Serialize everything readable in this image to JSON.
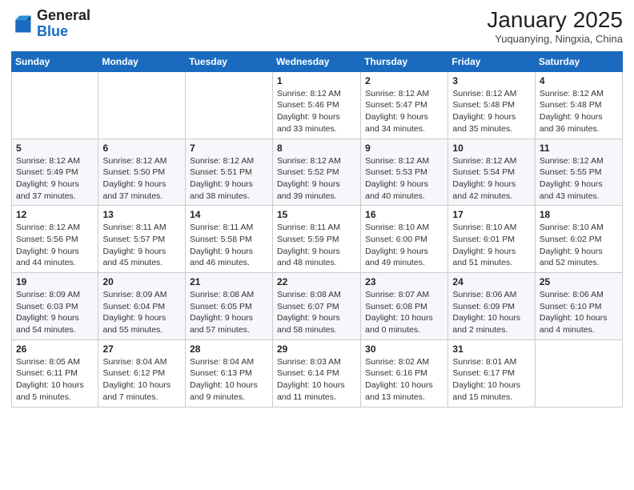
{
  "header": {
    "logo": {
      "line1": "General",
      "line2": "Blue"
    },
    "title": "January 2025",
    "location": "Yuquanying, Ningxia, China"
  },
  "weekdays": [
    "Sunday",
    "Monday",
    "Tuesday",
    "Wednesday",
    "Thursday",
    "Friday",
    "Saturday"
  ],
  "weeks": [
    [
      {
        "day": "",
        "sunrise": "",
        "sunset": "",
        "daylight": ""
      },
      {
        "day": "",
        "sunrise": "",
        "sunset": "",
        "daylight": ""
      },
      {
        "day": "",
        "sunrise": "",
        "sunset": "",
        "daylight": ""
      },
      {
        "day": "1",
        "sunrise": "Sunrise: 8:12 AM",
        "sunset": "Sunset: 5:46 PM",
        "daylight": "Daylight: 9 hours and 33 minutes."
      },
      {
        "day": "2",
        "sunrise": "Sunrise: 8:12 AM",
        "sunset": "Sunset: 5:47 PM",
        "daylight": "Daylight: 9 hours and 34 minutes."
      },
      {
        "day": "3",
        "sunrise": "Sunrise: 8:12 AM",
        "sunset": "Sunset: 5:48 PM",
        "daylight": "Daylight: 9 hours and 35 minutes."
      },
      {
        "day": "4",
        "sunrise": "Sunrise: 8:12 AM",
        "sunset": "Sunset: 5:48 PM",
        "daylight": "Daylight: 9 hours and 36 minutes."
      }
    ],
    [
      {
        "day": "5",
        "sunrise": "Sunrise: 8:12 AM",
        "sunset": "Sunset: 5:49 PM",
        "daylight": "Daylight: 9 hours and 37 minutes."
      },
      {
        "day": "6",
        "sunrise": "Sunrise: 8:12 AM",
        "sunset": "Sunset: 5:50 PM",
        "daylight": "Daylight: 9 hours and 37 minutes."
      },
      {
        "day": "7",
        "sunrise": "Sunrise: 8:12 AM",
        "sunset": "Sunset: 5:51 PM",
        "daylight": "Daylight: 9 hours and 38 minutes."
      },
      {
        "day": "8",
        "sunrise": "Sunrise: 8:12 AM",
        "sunset": "Sunset: 5:52 PM",
        "daylight": "Daylight: 9 hours and 39 minutes."
      },
      {
        "day": "9",
        "sunrise": "Sunrise: 8:12 AM",
        "sunset": "Sunset: 5:53 PM",
        "daylight": "Daylight: 9 hours and 40 minutes."
      },
      {
        "day": "10",
        "sunrise": "Sunrise: 8:12 AM",
        "sunset": "Sunset: 5:54 PM",
        "daylight": "Daylight: 9 hours and 42 minutes."
      },
      {
        "day": "11",
        "sunrise": "Sunrise: 8:12 AM",
        "sunset": "Sunset: 5:55 PM",
        "daylight": "Daylight: 9 hours and 43 minutes."
      }
    ],
    [
      {
        "day": "12",
        "sunrise": "Sunrise: 8:12 AM",
        "sunset": "Sunset: 5:56 PM",
        "daylight": "Daylight: 9 hours and 44 minutes."
      },
      {
        "day": "13",
        "sunrise": "Sunrise: 8:11 AM",
        "sunset": "Sunset: 5:57 PM",
        "daylight": "Daylight: 9 hours and 45 minutes."
      },
      {
        "day": "14",
        "sunrise": "Sunrise: 8:11 AM",
        "sunset": "Sunset: 5:58 PM",
        "daylight": "Daylight: 9 hours and 46 minutes."
      },
      {
        "day": "15",
        "sunrise": "Sunrise: 8:11 AM",
        "sunset": "Sunset: 5:59 PM",
        "daylight": "Daylight: 9 hours and 48 minutes."
      },
      {
        "day": "16",
        "sunrise": "Sunrise: 8:10 AM",
        "sunset": "Sunset: 6:00 PM",
        "daylight": "Daylight: 9 hours and 49 minutes."
      },
      {
        "day": "17",
        "sunrise": "Sunrise: 8:10 AM",
        "sunset": "Sunset: 6:01 PM",
        "daylight": "Daylight: 9 hours and 51 minutes."
      },
      {
        "day": "18",
        "sunrise": "Sunrise: 8:10 AM",
        "sunset": "Sunset: 6:02 PM",
        "daylight": "Daylight: 9 hours and 52 minutes."
      }
    ],
    [
      {
        "day": "19",
        "sunrise": "Sunrise: 8:09 AM",
        "sunset": "Sunset: 6:03 PM",
        "daylight": "Daylight: 9 hours and 54 minutes."
      },
      {
        "day": "20",
        "sunrise": "Sunrise: 8:09 AM",
        "sunset": "Sunset: 6:04 PM",
        "daylight": "Daylight: 9 hours and 55 minutes."
      },
      {
        "day": "21",
        "sunrise": "Sunrise: 8:08 AM",
        "sunset": "Sunset: 6:05 PM",
        "daylight": "Daylight: 9 hours and 57 minutes."
      },
      {
        "day": "22",
        "sunrise": "Sunrise: 8:08 AM",
        "sunset": "Sunset: 6:07 PM",
        "daylight": "Daylight: 9 hours and 58 minutes."
      },
      {
        "day": "23",
        "sunrise": "Sunrise: 8:07 AM",
        "sunset": "Sunset: 6:08 PM",
        "daylight": "Daylight: 10 hours and 0 minutes."
      },
      {
        "day": "24",
        "sunrise": "Sunrise: 8:06 AM",
        "sunset": "Sunset: 6:09 PM",
        "daylight": "Daylight: 10 hours and 2 minutes."
      },
      {
        "day": "25",
        "sunrise": "Sunrise: 8:06 AM",
        "sunset": "Sunset: 6:10 PM",
        "daylight": "Daylight: 10 hours and 4 minutes."
      }
    ],
    [
      {
        "day": "26",
        "sunrise": "Sunrise: 8:05 AM",
        "sunset": "Sunset: 6:11 PM",
        "daylight": "Daylight: 10 hours and 5 minutes."
      },
      {
        "day": "27",
        "sunrise": "Sunrise: 8:04 AM",
        "sunset": "Sunset: 6:12 PM",
        "daylight": "Daylight: 10 hours and 7 minutes."
      },
      {
        "day": "28",
        "sunrise": "Sunrise: 8:04 AM",
        "sunset": "Sunset: 6:13 PM",
        "daylight": "Daylight: 10 hours and 9 minutes."
      },
      {
        "day": "29",
        "sunrise": "Sunrise: 8:03 AM",
        "sunset": "Sunset: 6:14 PM",
        "daylight": "Daylight: 10 hours and 11 minutes."
      },
      {
        "day": "30",
        "sunrise": "Sunrise: 8:02 AM",
        "sunset": "Sunset: 6:16 PM",
        "daylight": "Daylight: 10 hours and 13 minutes."
      },
      {
        "day": "31",
        "sunrise": "Sunrise: 8:01 AM",
        "sunset": "Sunset: 6:17 PM",
        "daylight": "Daylight: 10 hours and 15 minutes."
      },
      {
        "day": "",
        "sunrise": "",
        "sunset": "",
        "daylight": ""
      }
    ]
  ]
}
